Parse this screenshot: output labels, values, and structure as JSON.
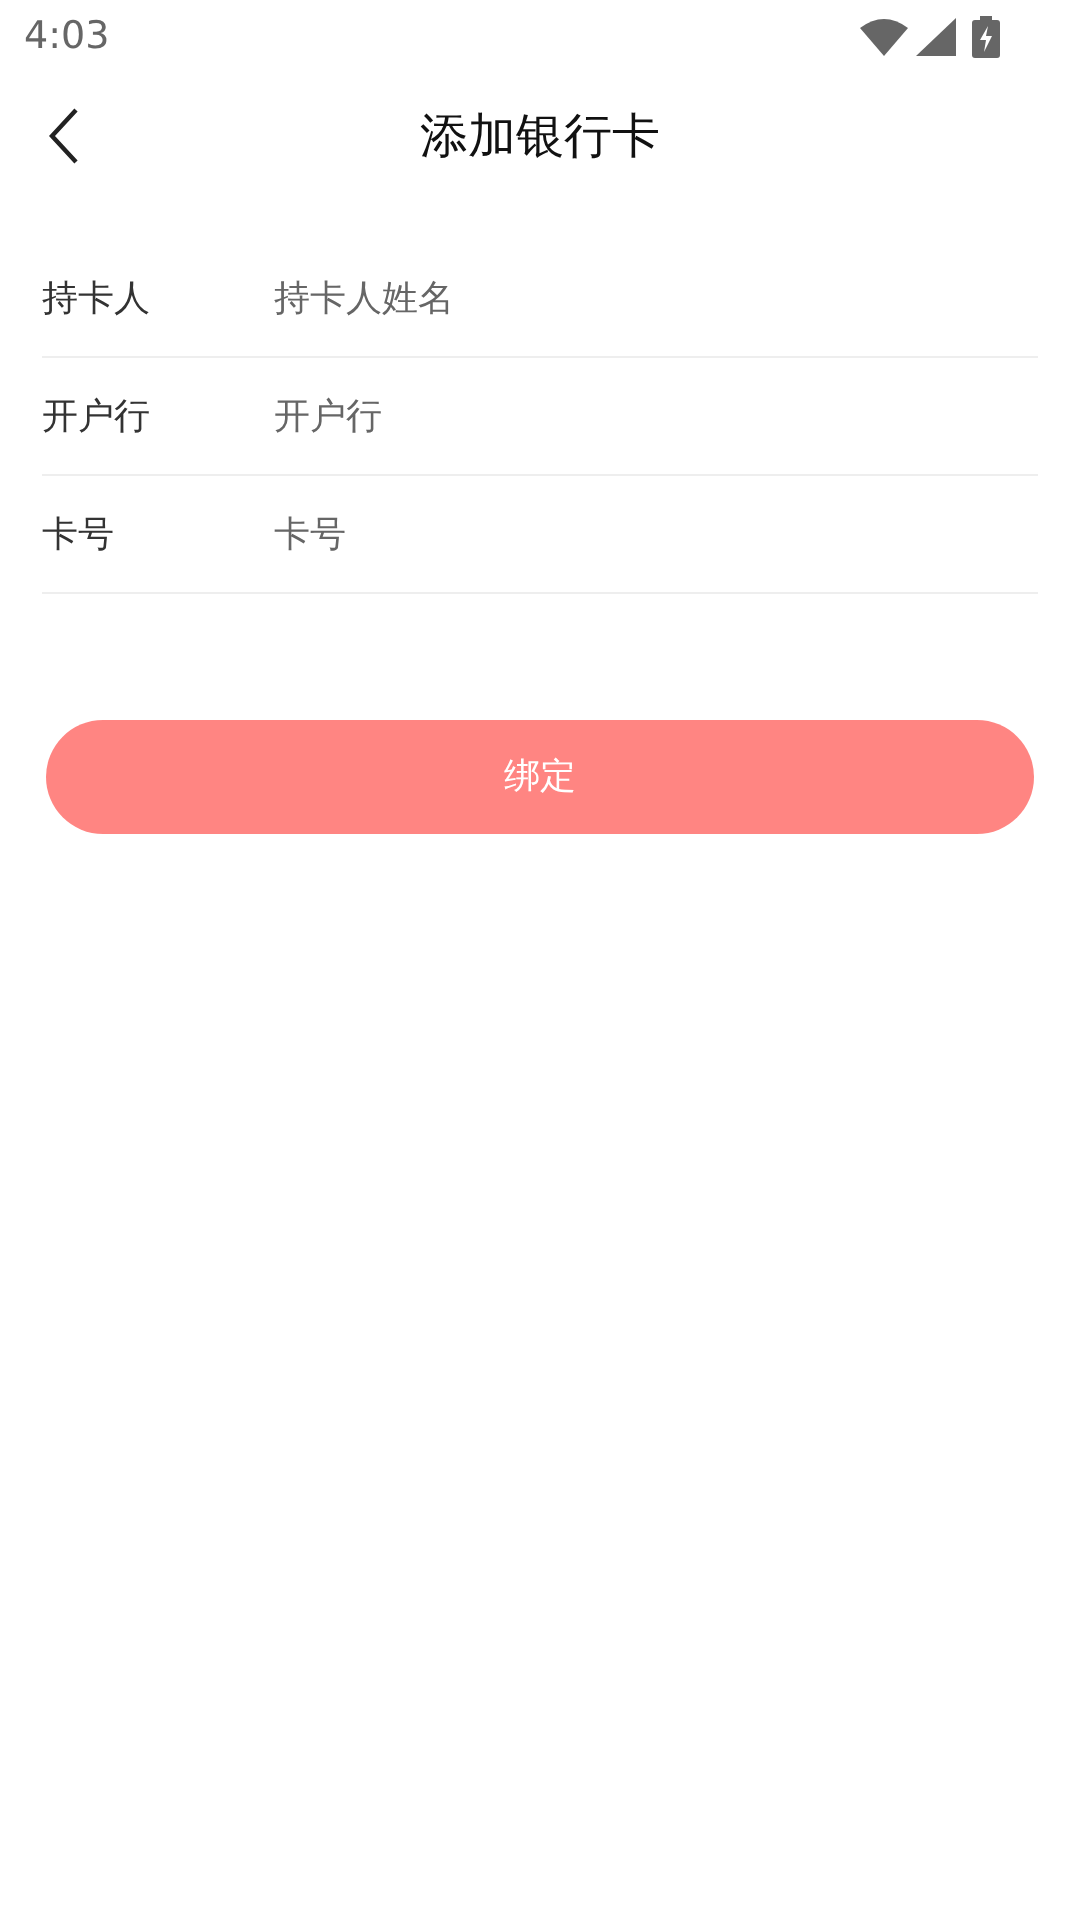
{
  "status_bar": {
    "time": "4:03"
  },
  "header": {
    "title": "添加银行卡"
  },
  "fields": [
    {
      "label": "持卡人",
      "placeholder": "持卡人姓名"
    },
    {
      "label": "开户行",
      "placeholder": "开户行"
    },
    {
      "label": "卡号",
      "placeholder": "卡号"
    }
  ],
  "submit_button": {
    "label": "绑定"
  }
}
